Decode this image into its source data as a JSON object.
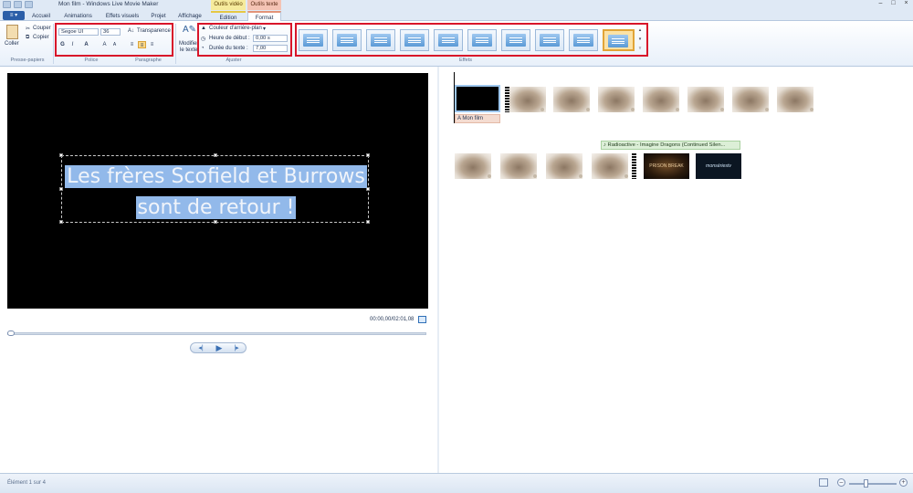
{
  "window": {
    "title": "Mon film - Windows Live Movie Maker",
    "context_video_label": "Outils vidéo",
    "context_text_label": "Outils texte"
  },
  "tabs": [
    "Accueil",
    "Animations",
    "Effets visuels",
    "Projet",
    "Affichage",
    "Edition",
    "Format"
  ],
  "active_tab": "Format",
  "ribbon": {
    "clipboard": {
      "paste": "Coller",
      "cut": "Couper",
      "copy": "Copier",
      "group": "Presse-papiers"
    },
    "font": {
      "family": "Segoe UI",
      "size": "36",
      "bold": "G",
      "italic": "I",
      "color": "A",
      "grow": "A",
      "shrink": "A",
      "group": "Police"
    },
    "paragraph": {
      "transparency": "Transparence",
      "group": "Paragraphe"
    },
    "edit_text": {
      "line1": "Modifier",
      "line2": "le texte"
    },
    "adjust": {
      "bg_color": "Couleur d'arrière-plan",
      "start_label": "Heure de début :",
      "start_value": "0,00 s",
      "duration_label": "Durée du texte :",
      "duration_value": "7,00",
      "group": "Ajuster"
    },
    "effects_group": "Effets"
  },
  "preview": {
    "line1": "Les frères Scofield et Burrows",
    "line2": "sont de retour !",
    "timecode": "00:00,00/02:01,08"
  },
  "storyboard": {
    "caption_item": "Mon film",
    "music_item": "Radioactive - Imagine Dragons (Continued Silen...",
    "title_logo": "PRISON BREAK",
    "tv_logo": "monsériestv"
  },
  "status": {
    "text": "Élément 1 sur 4"
  },
  "colors": {
    "selection_highlight": "#92b9ea",
    "annotation_red": "#d8152a",
    "ribbon_bg": "#dfe9f5"
  }
}
